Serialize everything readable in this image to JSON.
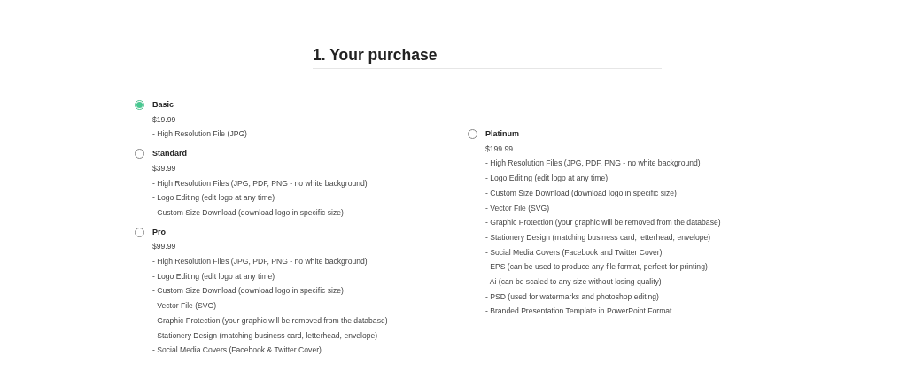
{
  "heading": "1. Your purchase",
  "columns": [
    {
      "plans": [
        {
          "name": "Basic",
          "price": "$19.99",
          "selected": true,
          "features": [
            "- High Resolution File (JPG)"
          ]
        },
        {
          "name": "Standard",
          "price": "$39.99",
          "selected": false,
          "features": [
            "- High Resolution Files (JPG, PDF, PNG - no white background)",
            "- Logo Editing (edit logo at any time)",
            "- Custom Size Download (download logo in specific size)"
          ]
        },
        {
          "name": "Pro",
          "price": "$99.99",
          "selected": false,
          "features": [
            "- High Resolution Files (JPG, PDF, PNG - no white background)",
            "- Logo Editing (edit logo at any time)",
            "- Custom Size Download (download logo in specific size)",
            "- Vector File (SVG)",
            "- Graphic Protection (your graphic will be removed from the database)",
            "- Stationery Design (matching business card, letterhead, envelope)",
            "- Social Media Covers (Facebook & Twitter Cover)"
          ]
        }
      ]
    },
    {
      "plans": [
        {
          "name": "Platinum",
          "price": "$199.99",
          "selected": false,
          "features": [
            "- High Resolution Files (JPG, PDF, PNG - no white background)",
            "- Logo Editing (edit logo at any time)",
            "- Custom Size Download (download logo in specific size)",
            "- Vector File (SVG)",
            "- Graphic Protection (your graphic will be removed from the database)",
            "- Stationery Design (matching business card, letterhead, envelope)",
            "- Social Media Covers (Facebook and Twitter Cover)",
            "- EPS (can be used to produce any file format, perfect for printing)",
            "- Ai (can be scaled to any size without losing quality)",
            "- PSD (used for watermarks and photoshop editing)",
            "- Branded Presentation Template in PowerPoint Format"
          ]
        }
      ]
    }
  ]
}
